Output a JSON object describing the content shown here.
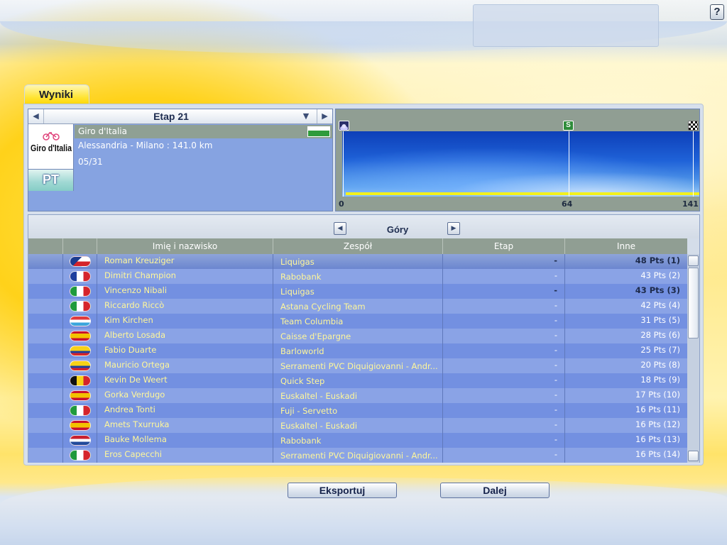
{
  "help": {
    "label": "?"
  },
  "tab": {
    "label": "Wyniki"
  },
  "stage": {
    "title": "Etap 21",
    "prev_icon": "◀",
    "next_icon": "▶",
    "dropdown_icon": "▼",
    "race_name": "Giro d'Italia",
    "route": "Alessandria - Milano : 141.0 km",
    "date": "05/31",
    "badge": "PT",
    "logo_text": "Giro d'Italia",
    "flag": "IT"
  },
  "profile": {
    "start_km": "0",
    "sprint_km": "64",
    "end_km": "141",
    "sprint_label": "S",
    "icons": [
      "mountain-icon",
      "sprint-icon",
      "finish-flag-icon"
    ]
  },
  "classification": {
    "title": "Góry",
    "prev_icon": "◀",
    "next_icon": "▶"
  },
  "table": {
    "columns": [
      "",
      "",
      "Imię i nazwisko",
      "Zespół",
      "Etap",
      "Inne"
    ],
    "rows": [
      {
        "flag": "CZ",
        "name": "Roman Kreuziger",
        "team": "Liquigas",
        "stage": "-",
        "other": "48 Pts (1)",
        "bold": true
      },
      {
        "flag": "FR",
        "name": "Dimitri Champion",
        "team": "Rabobank",
        "stage": "-",
        "other": "43 Pts (2)",
        "bold": false
      },
      {
        "flag": "IT",
        "name": "Vincenzo Nibali",
        "team": "Liquigas",
        "stage": "-",
        "other": "43 Pts (3)",
        "bold": true
      },
      {
        "flag": "IT",
        "name": "Riccardo Riccò",
        "team": "Astana Cycling Team",
        "stage": "-",
        "other": "42 Pts (4)",
        "bold": false
      },
      {
        "flag": "LU",
        "name": "Kim Kirchen",
        "team": "Team Columbia",
        "stage": "-",
        "other": "31 Pts (5)",
        "bold": false
      },
      {
        "flag": "ES",
        "name": "Alberto Losada",
        "team": "Caisse d'Epargne",
        "stage": "-",
        "other": "28 Pts (6)",
        "bold": false
      },
      {
        "flag": "CO",
        "name": "Fabio Duarte",
        "team": "Barloworld",
        "stage": "-",
        "other": "25 Pts (7)",
        "bold": false
      },
      {
        "flag": "CO",
        "name": "Mauricio Ortega",
        "team": " Serramenti PVC Diquigiovanni - Andr...",
        "stage": "-",
        "other": "20 Pts (8)",
        "bold": false
      },
      {
        "flag": "BE",
        "name": "Kevin De Weert",
        "team": "Quick Step",
        "stage": "-",
        "other": "18 Pts (9)",
        "bold": false
      },
      {
        "flag": "ES",
        "name": "Gorka Verdugo",
        "team": "Euskaltel - Euskadi",
        "stage": "-",
        "other": "17 Pts (10)",
        "bold": false
      },
      {
        "flag": "IT",
        "name": "Andrea Tonti",
        "team": "Fuji - Servetto",
        "stage": "-",
        "other": "16 Pts (11)",
        "bold": false
      },
      {
        "flag": "ES",
        "name": "Amets Txurruka",
        "team": "Euskaltel - Euskadi",
        "stage": "-",
        "other": "16 Pts (12)",
        "bold": false
      },
      {
        "flag": "NL",
        "name": "Bauke Mollema",
        "team": "Rabobank",
        "stage": "-",
        "other": "16 Pts (13)",
        "bold": false
      },
      {
        "flag": "IT",
        "name": "Eros Capecchi",
        "team": " Serramenti PVC Diquigiovanni - Andr...",
        "stage": "-",
        "other": "16 Pts (14)",
        "bold": false
      }
    ]
  },
  "buttons": {
    "export": "Eksportuj",
    "next": "Dalej"
  }
}
